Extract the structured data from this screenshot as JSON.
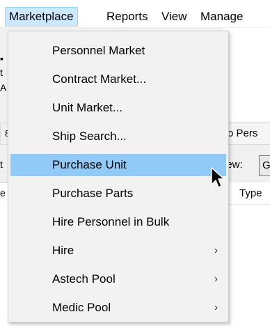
{
  "menubar": {
    "items": [
      {
        "label": "Marketplace",
        "active": true
      },
      {
        "label": "Reports"
      },
      {
        "label": "View"
      },
      {
        "label": "Manage"
      }
    ]
  },
  "dropdown": {
    "items": [
      {
        "label": "Personnel Market",
        "submenu": false
      },
      {
        "label": "Contract Market...",
        "submenu": false
      },
      {
        "label": "Unit Market...",
        "submenu": false
      },
      {
        "label": "Ship Search...",
        "submenu": false
      },
      {
        "label": "Purchase Unit",
        "submenu": false,
        "highlighted": true
      },
      {
        "label": "Purchase Parts",
        "submenu": false
      },
      {
        "label": "Hire Personnel in Bulk",
        "submenu": false
      },
      {
        "label": "Hire",
        "submenu": true
      },
      {
        "label": "Astech Pool",
        "submenu": true
      },
      {
        "label": "Medic Pool",
        "submenu": true
      }
    ],
    "submenu_arrow": "›"
  },
  "background": {
    "tab_fragment": "o Pers",
    "left_tab_fragment": "8",
    "view_label": "iew:",
    "view_value": "G",
    "type_header": "Type",
    "left_fragments": [
      "t",
      "A",
      "t",
      "e"
    ]
  },
  "colors": {
    "menu_highlight": "#91c9f7",
    "menubar_active": "#cce8ff"
  },
  "icons": {
    "cursor": "mouse-pointer-icon",
    "submenu": "chevron-right-icon"
  }
}
